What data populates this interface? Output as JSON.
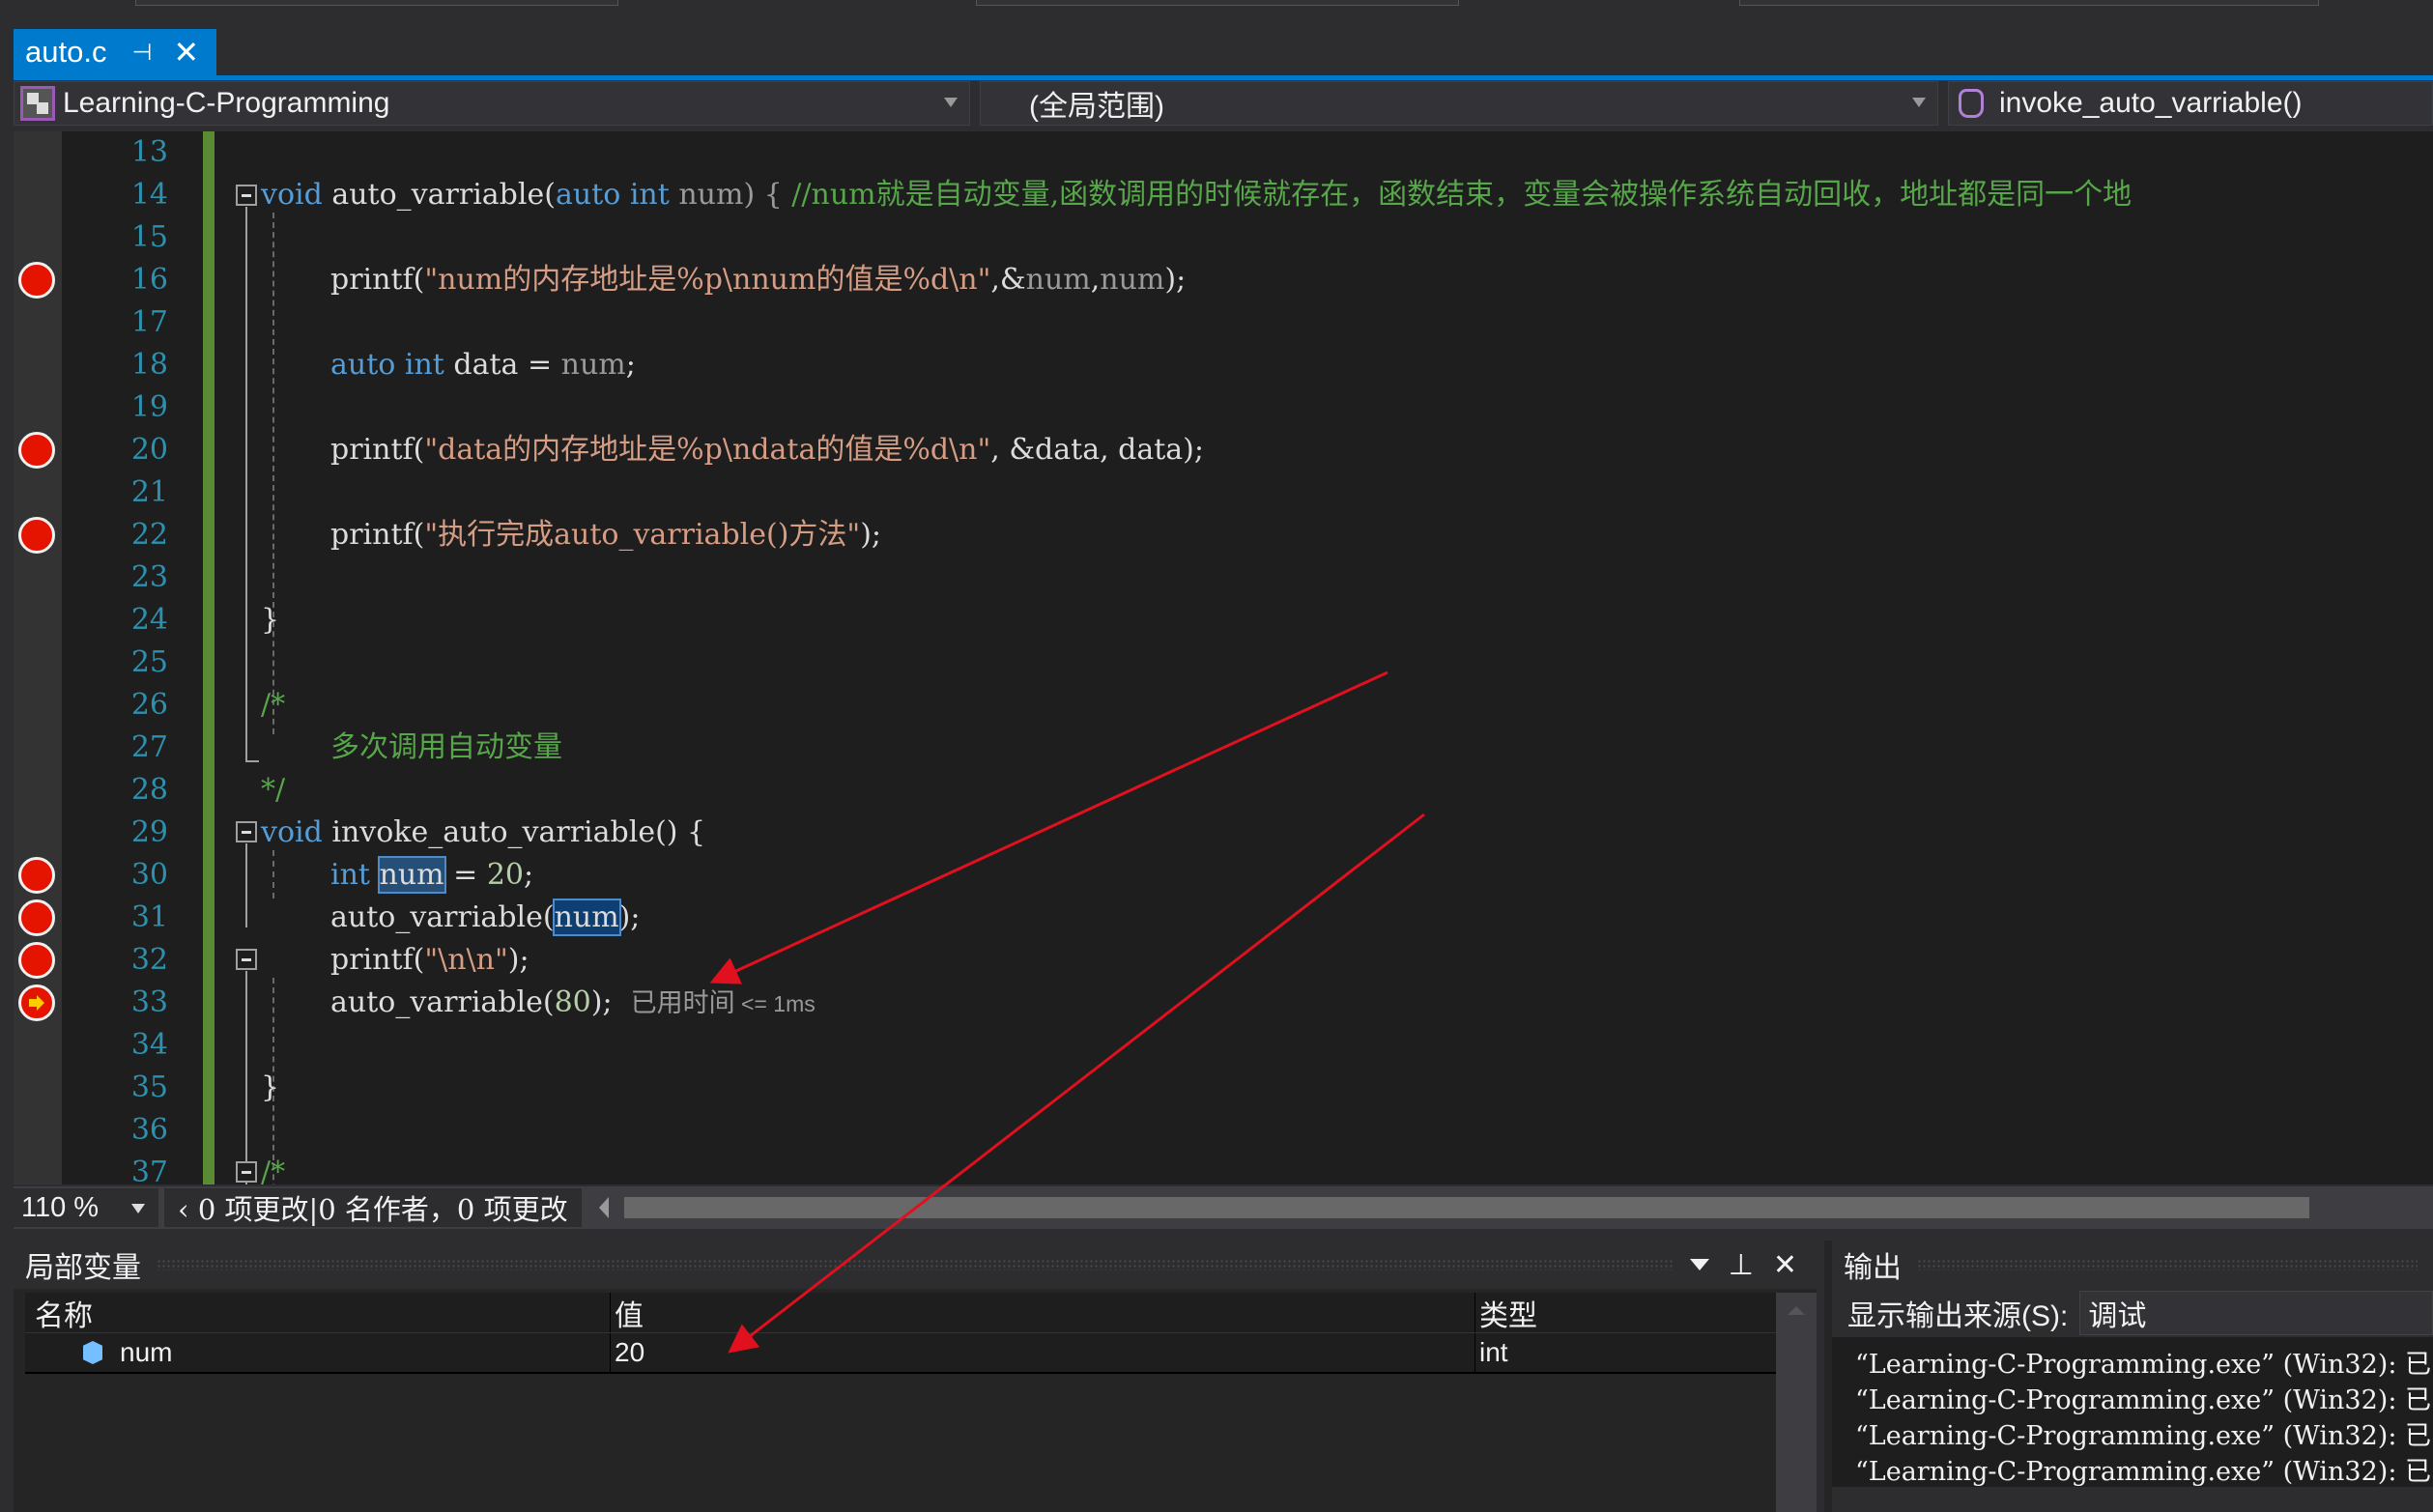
{
  "tab": {
    "title": "auto.c",
    "pin_icon": "pin-icon",
    "close_icon": "close-icon"
  },
  "navbar": {
    "project": "Learning-C-Programming",
    "scope": "(全局范围)",
    "member": "invoke_auto_varriable()"
  },
  "editor": {
    "line_numbers": [
      "13",
      "14",
      "15",
      "16",
      "17",
      "18",
      "19",
      "20",
      "21",
      "22",
      "23",
      "24",
      "25",
      "26",
      "27",
      "28",
      "29",
      "30",
      "31",
      "32",
      "33",
      "34",
      "35",
      "36",
      "37"
    ],
    "breakpoint_lines": [
      16,
      20,
      22,
      30,
      31,
      32
    ],
    "current_line": 33,
    "lines": {
      "l14_kw": "void",
      "l14_name": " auto_varriable(",
      "l14_kw2": "auto",
      "l14_sp": " ",
      "l14_kw3": "int",
      "l14_param": " num",
      "l14_close": ") {",
      "l14_comment": " //num就是自动变量,函数调用的时候就存在，函数结束，变量会被操作系统自动回收，地址都是同一个地",
      "l16_fn": "printf(",
      "l16_str": "\"num的内存地址是%p\\nnum的值是%d\\n\"",
      "l16_args_a": ",&",
      "l16_args_b": "num",
      "l16_args_c": ",",
      "l16_args_d": "num",
      "l16_end": ");",
      "l18_kw": "auto",
      "l18_kw2": "int",
      "l18_rest": " data = ",
      "l18_num": "num",
      "l18_end": ";",
      "l20_fn": "printf(",
      "l20_str": "\"data的内存地址是%p\\ndata的值是%d\\n\"",
      "l20_rest": ", &data, data);",
      "l22_fn": "printf(",
      "l22_str": "\"执行完成auto_varriable()方法\"",
      "l22_end": ");",
      "l24": "}",
      "l26": "/*",
      "l27": "多次调用自动变量",
      "l28": "*/",
      "l29_kw": "void",
      "l29_rest": " invoke_auto_varriable() {",
      "l30_kw": "int",
      "l30_var": "num",
      "l30_eq": " = ",
      "l30_num": "20",
      "l30_end": ";",
      "l31_fn": "auto_varriable(",
      "l31_var": "num",
      "l31_end": ");",
      "l32_fn": "printf(",
      "l32_str": "\"\\n\\n\"",
      "l32_end": ");",
      "l33_fn": "auto_varriable(",
      "l33_num": "80",
      "l33_end": ");",
      "l33_perf": "已用时间",
      "l33_perf_val": " <= 1ms",
      "l35": "}",
      "l37": "/*"
    }
  },
  "statusbar": {
    "zoom": "110 %",
    "changes": "‹ 0 项更改|0 名作者，0 项更改"
  },
  "locals_panel": {
    "title": "局部变量",
    "columns": [
      "名称",
      "值",
      "类型"
    ],
    "rows": [
      {
        "name": "num",
        "value": "20",
        "type": "int"
      }
    ]
  },
  "output_panel": {
    "title": "输出",
    "source_label": "显示输出来源(S):",
    "source_value": "调试",
    "lines": [
      "“Learning-C-Programming.exe” (Win32): 已",
      "“Learning-C-Programming.exe” (Win32): 已",
      "“Learning-C-Programming.exe” (Win32): 已",
      "“Learning-C-Programming.exe” (Win32): 已"
    ]
  },
  "colors": {
    "accent": "#007acc",
    "breakpoint": "#e51400",
    "annotation_arrow": "#e0101e",
    "keyword": "#569cd6",
    "string": "#d69d85",
    "comment": "#57a64a"
  }
}
